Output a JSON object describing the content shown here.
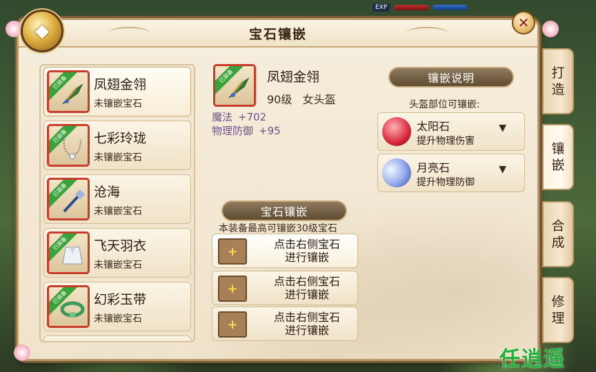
{
  "hud": {
    "exp_label": "EXP"
  },
  "window": {
    "title": "宝石镶嵌",
    "close_label": "✕"
  },
  "equipment_list": [
    {
      "name": "凤翅金翎",
      "status": "未镶嵌宝石",
      "badge": "已装备",
      "selected": true
    },
    {
      "name": "七彩玲珑",
      "status": "未镶嵌宝石",
      "badge": "已装备",
      "selected": false
    },
    {
      "name": "沧海",
      "status": "未镶嵌宝石",
      "badge": "已装备",
      "selected": false
    },
    {
      "name": "飞天羽衣",
      "status": "未镶嵌宝石",
      "badge": "已装备",
      "selected": false
    },
    {
      "name": "幻彩玉带",
      "status": "未镶嵌宝石",
      "badge": "已装备",
      "selected": false
    }
  ],
  "detail": {
    "badge": "已装备",
    "name": "凤翅金翎",
    "level": "90级",
    "slot_type": "女头盔",
    "stats": [
      {
        "label": "魔法",
        "value": "+702"
      },
      {
        "label": "物理防御",
        "value": "+95"
      }
    ]
  },
  "inlay_section": {
    "title": "宝石镶嵌",
    "hint": "本装备最高可镶嵌30级宝石",
    "sockets": [
      {
        "line1": "点击右侧宝石",
        "line2": "进行镶嵌"
      },
      {
        "line1": "点击右侧宝石",
        "line2": "进行镶嵌"
      },
      {
        "line1": "点击右侧宝石",
        "line2": "进行镶嵌"
      }
    ]
  },
  "gems_section": {
    "title": "镶嵌说明",
    "hint": "头盔部位可镶嵌:",
    "gems": [
      {
        "name": "太阳石",
        "desc": "提升物理伤害",
        "icon": "sun-stone-icon",
        "color": "#d8283a"
      },
      {
        "name": "月亮石",
        "desc": "提升物理防御",
        "icon": "moon-stone-icon",
        "color": "#5a7ad8"
      }
    ],
    "arrow": "▼"
  },
  "side_tabs": [
    {
      "line1": "打",
      "line2": "造",
      "active": false
    },
    {
      "line1": "镶",
      "line2": "嵌",
      "active": true
    },
    {
      "line1": "合",
      "line2": "成",
      "active": false
    },
    {
      "line1": "修",
      "line2": "理",
      "active": false
    }
  ],
  "watermark": "任逍遥"
}
